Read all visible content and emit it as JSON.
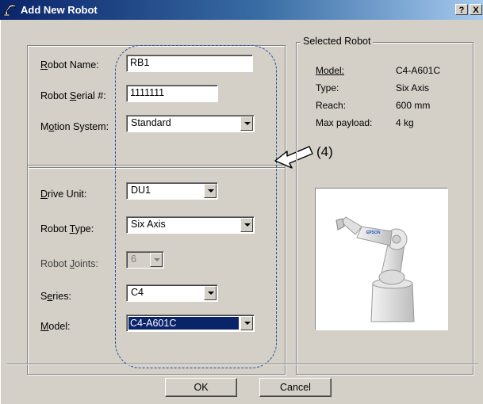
{
  "window": {
    "title": "Add New Robot",
    "help_label": "?",
    "close_label": "X"
  },
  "robot_name": {
    "label": "Robot Name:",
    "value": "RB1"
  },
  "robot_serial": {
    "label": "Robot Serial #:",
    "value": "1111111"
  },
  "motion_system": {
    "label": "Motion System:",
    "value": "Standard"
  },
  "drive_unit": {
    "label": "Drive Unit:",
    "value": "DU1"
  },
  "robot_type": {
    "label": "Robot Type:",
    "value": "Six Axis"
  },
  "robot_joints": {
    "label": "Robot Joints:",
    "value": "6"
  },
  "series": {
    "label": "Series:",
    "value": "C4"
  },
  "model": {
    "label": "Model:",
    "value": "C4-A601C"
  },
  "selected_robot": {
    "group_title": "Selected Robot",
    "rows": [
      {
        "key": "Model:",
        "value": "C4-A601C"
      },
      {
        "key": "Type:",
        "value": "Six Axis"
      },
      {
        "key": "Reach:",
        "value": "600 mm"
      },
      {
        "key": "Max payload:",
        "value": "4 kg"
      }
    ],
    "image_brand": "EPSON"
  },
  "annotation": {
    "label": "(4)"
  },
  "buttons": {
    "ok": "OK",
    "cancel": "Cancel"
  },
  "colors": {
    "title_gradient_start": "#0a246a",
    "selection": "#0a246a",
    "annotation_outline": "#1f4fa0"
  }
}
